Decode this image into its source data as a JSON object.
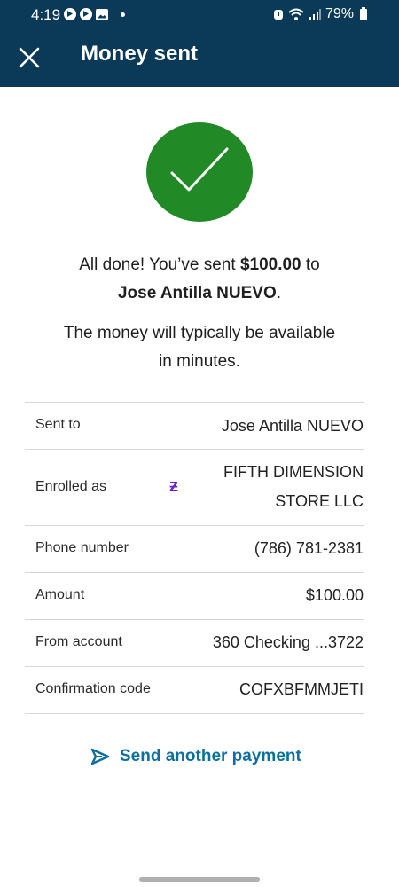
{
  "status_bar": {
    "time": "4:19",
    "battery": "79%"
  },
  "app_bar": {
    "title": "Money sent"
  },
  "confirmation": {
    "line1_prefix": "All done! You’ve sent ",
    "amount": "$100.00",
    "line1_suffix": " to",
    "recipient": "Jose Antilla NUEVO",
    "period": ".",
    "availability_line1": "The money will typically be available",
    "availability_line2": "in minutes."
  },
  "details": {
    "sent_to": {
      "label": "Sent to",
      "value": "Jose Antilla NUEVO"
    },
    "enrolled_as": {
      "label": "Enrolled as",
      "value_line1": "FIFTH DIMENSION",
      "value_line2": "STORE LLC",
      "icon_glyph": "ƶ"
    },
    "phone": {
      "label": "Phone number",
      "value": "(786) 781-2381"
    },
    "amount": {
      "label": "Amount",
      "value": "$100.00"
    },
    "from_account": {
      "label": "From account",
      "value": "360 Checking ...3722"
    },
    "confirmation_code": {
      "label": "Confirmation code",
      "value": "COFXBFMMJETI"
    }
  },
  "actions": {
    "send_another": "Send another payment"
  },
  "colors": {
    "header": "#0a3a57",
    "success": "#218a27",
    "link": "#0d6fa0",
    "zelle": "#6d1ed4"
  }
}
